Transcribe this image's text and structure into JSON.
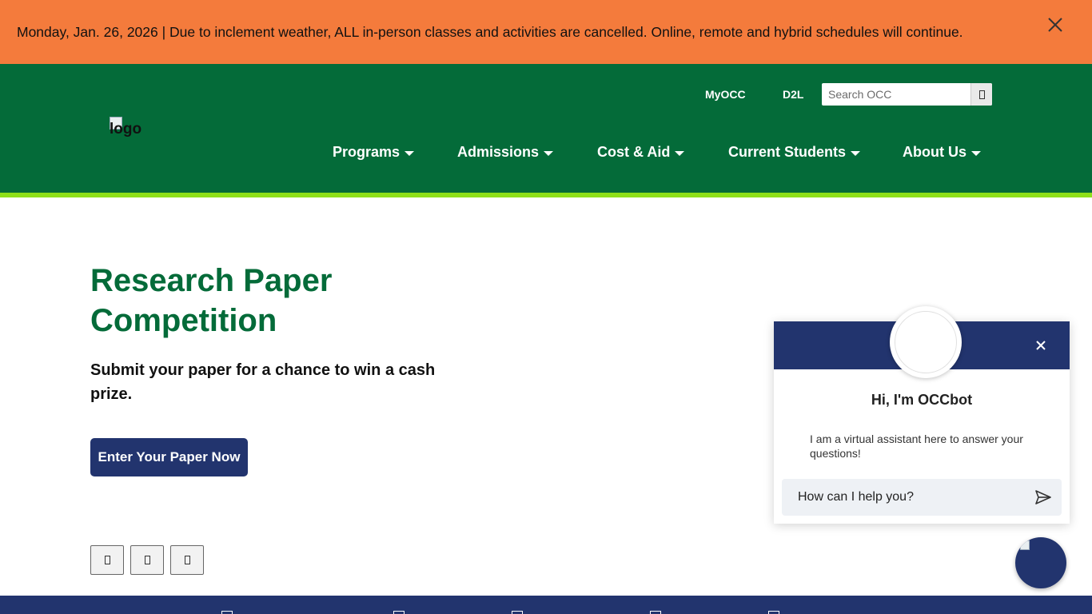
{
  "alert": {
    "message": "Monday, Jan. 26, 2026 | Due to inclement weather, ALL in-person classes and activities are cancelled. Online, remote and hybrid schedules will continue.",
    "close_icon": "close-icon"
  },
  "header": {
    "logo_alt": "logo",
    "utility_links": [
      "MyOCC",
      "D2L"
    ],
    "search": {
      "placeholder": "Search OCC",
      "value": ""
    },
    "nav": [
      "Programs",
      "Admissions",
      "Cost & Aid",
      "Current Students",
      "About Us"
    ]
  },
  "hero": {
    "title": "Research Paper Competition",
    "subtitle": "Submit your paper for a chance to win a cash prize.",
    "button_label": "Enter Your Paper Now"
  },
  "chatbot": {
    "greeting": "Hi, I'm OCCbot",
    "message": "I am a virtual assistant here to answer your questions!",
    "input_placeholder": "How can I help you?",
    "input_value": ""
  },
  "colors": {
    "alert_bg": "#f47b3c",
    "header_bg": "#046b39",
    "accent_stripe": "#8ee01a",
    "navy": "#22346e",
    "title_green": "#046b39"
  }
}
